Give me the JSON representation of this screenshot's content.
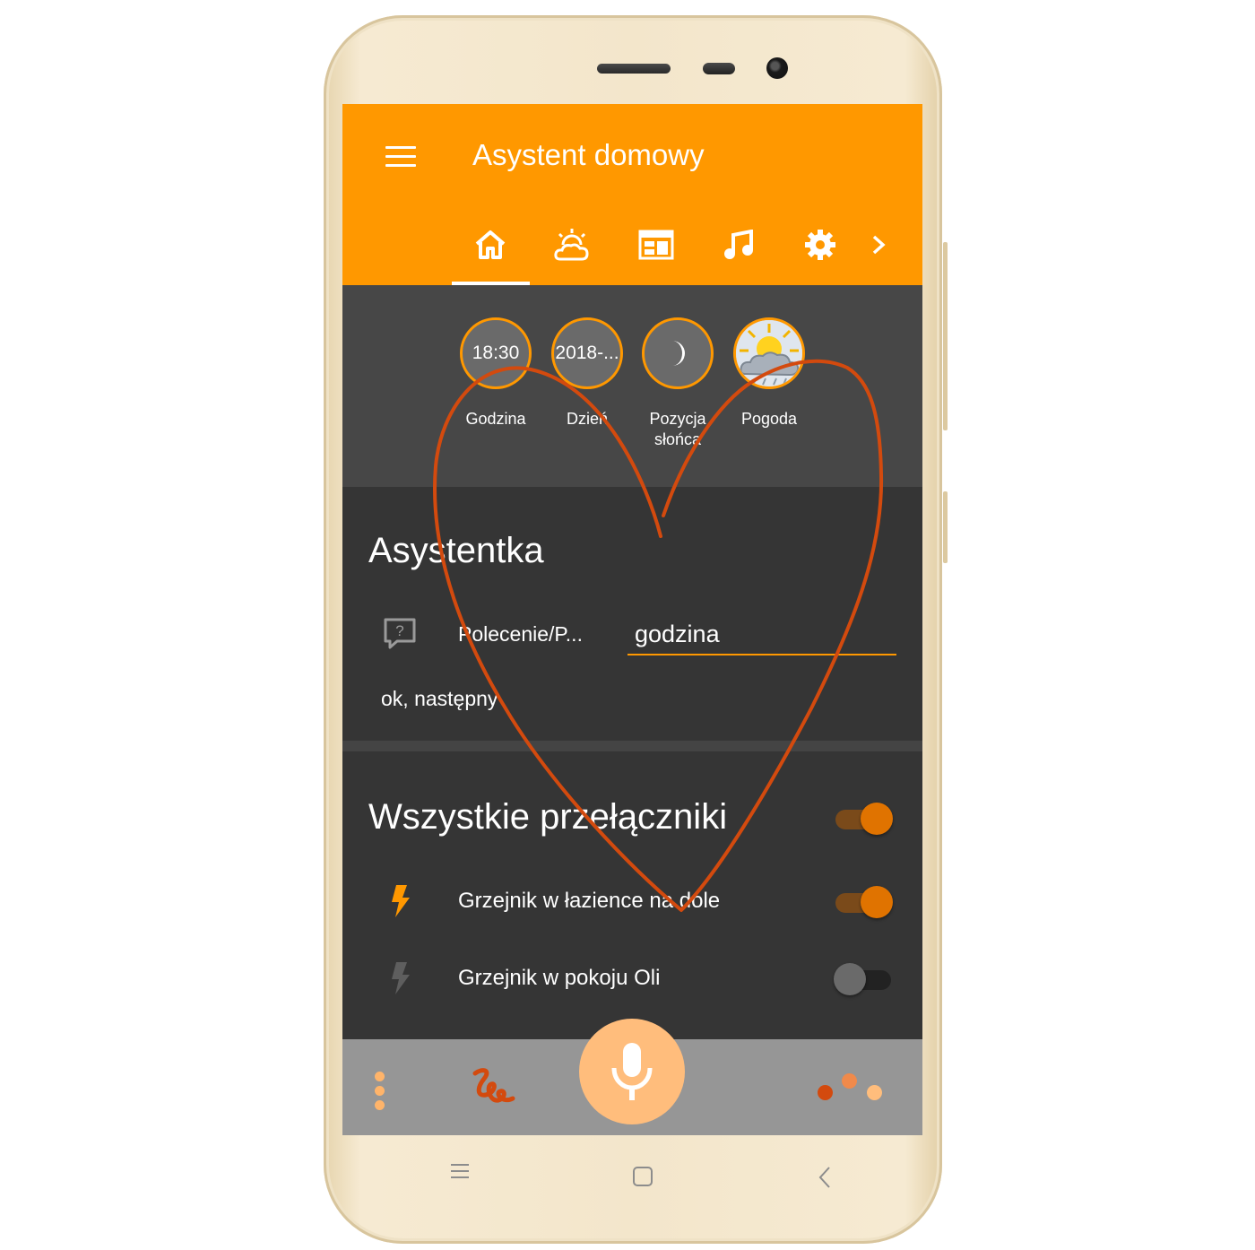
{
  "app": {
    "title": "Asystent domowy"
  },
  "tabs": [
    {
      "icon": "home-icon",
      "active": true
    },
    {
      "icon": "weather-sunrise-icon",
      "active": false
    },
    {
      "icon": "calendar-icon",
      "active": false
    },
    {
      "icon": "music-note-icon",
      "active": false
    },
    {
      "icon": "gear-icon",
      "active": false
    },
    {
      "icon": "chevron-right-icon",
      "active": false
    }
  ],
  "badges": [
    {
      "value": "18:30",
      "label": "Godzina"
    },
    {
      "value": "2018-...",
      "label": "Dzień"
    },
    {
      "value": "",
      "icon": "crescent-moon-icon",
      "label": "Pozycja słońca"
    },
    {
      "value": "",
      "icon": "weather-cloudy-sun-icon",
      "label": "Pogoda"
    }
  ],
  "assistant": {
    "title": "Asystentka",
    "command_label": "Polecenie/P...",
    "command_value": "godzina",
    "reply": "ok, następny"
  },
  "switches": {
    "title": "Wszystkie przełączniki",
    "all_on": true,
    "items": [
      {
        "label": "Grzejnik w łazience na dole",
        "on": true,
        "icon": "flash-icon"
      },
      {
        "label": "Grzejnik w pokoju Oli",
        "on": false,
        "icon": "flash-icon"
      }
    ]
  },
  "colors": {
    "accent": "#ff9800",
    "switch_on": "#e07300",
    "heart_stroke": "#d34a0e",
    "bottom_bar": "#969696",
    "mic_button": "#ffbd7c"
  }
}
